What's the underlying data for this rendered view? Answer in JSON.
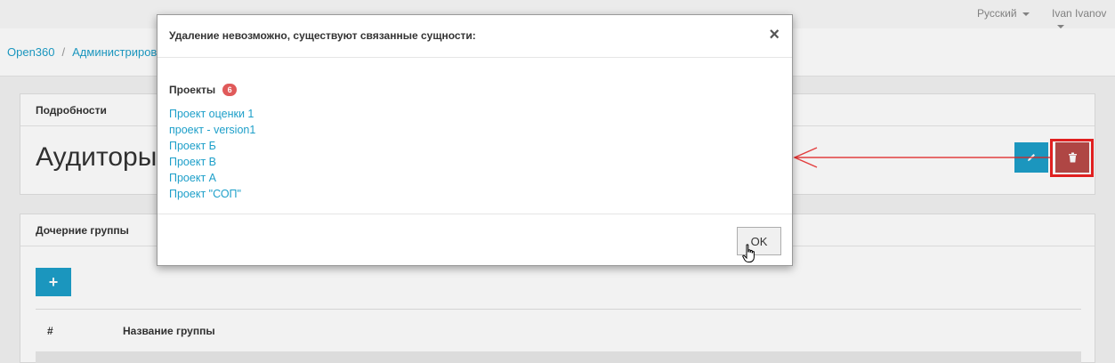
{
  "topbar": {
    "language": "Русский",
    "user": "Ivan Ivanov"
  },
  "breadcrumb": {
    "items": [
      "Open360",
      "Администрирование"
    ],
    "separator": "/"
  },
  "details_panel": {
    "header": "Подробности",
    "title": "Аудиторы"
  },
  "child_groups_panel": {
    "header": "Дочерние группы",
    "add_label": "+",
    "columns": [
      "#",
      "Название группы"
    ]
  },
  "modal": {
    "title": "Удаление невозможно, существуют связанные сущности:",
    "close_label": "×",
    "section_title": "Проекты",
    "section_count": "6",
    "projects": [
      "Проект оценки 1",
      "проект - version1",
      "Проект Б",
      "Проект В",
      "Проект А",
      "Проект \"СОП\""
    ],
    "ok_label": "OK"
  },
  "colors": {
    "accent": "#1d9fc9",
    "danger": "#b94a48",
    "badge": "#e05a5a",
    "annotation": "#e02020"
  }
}
